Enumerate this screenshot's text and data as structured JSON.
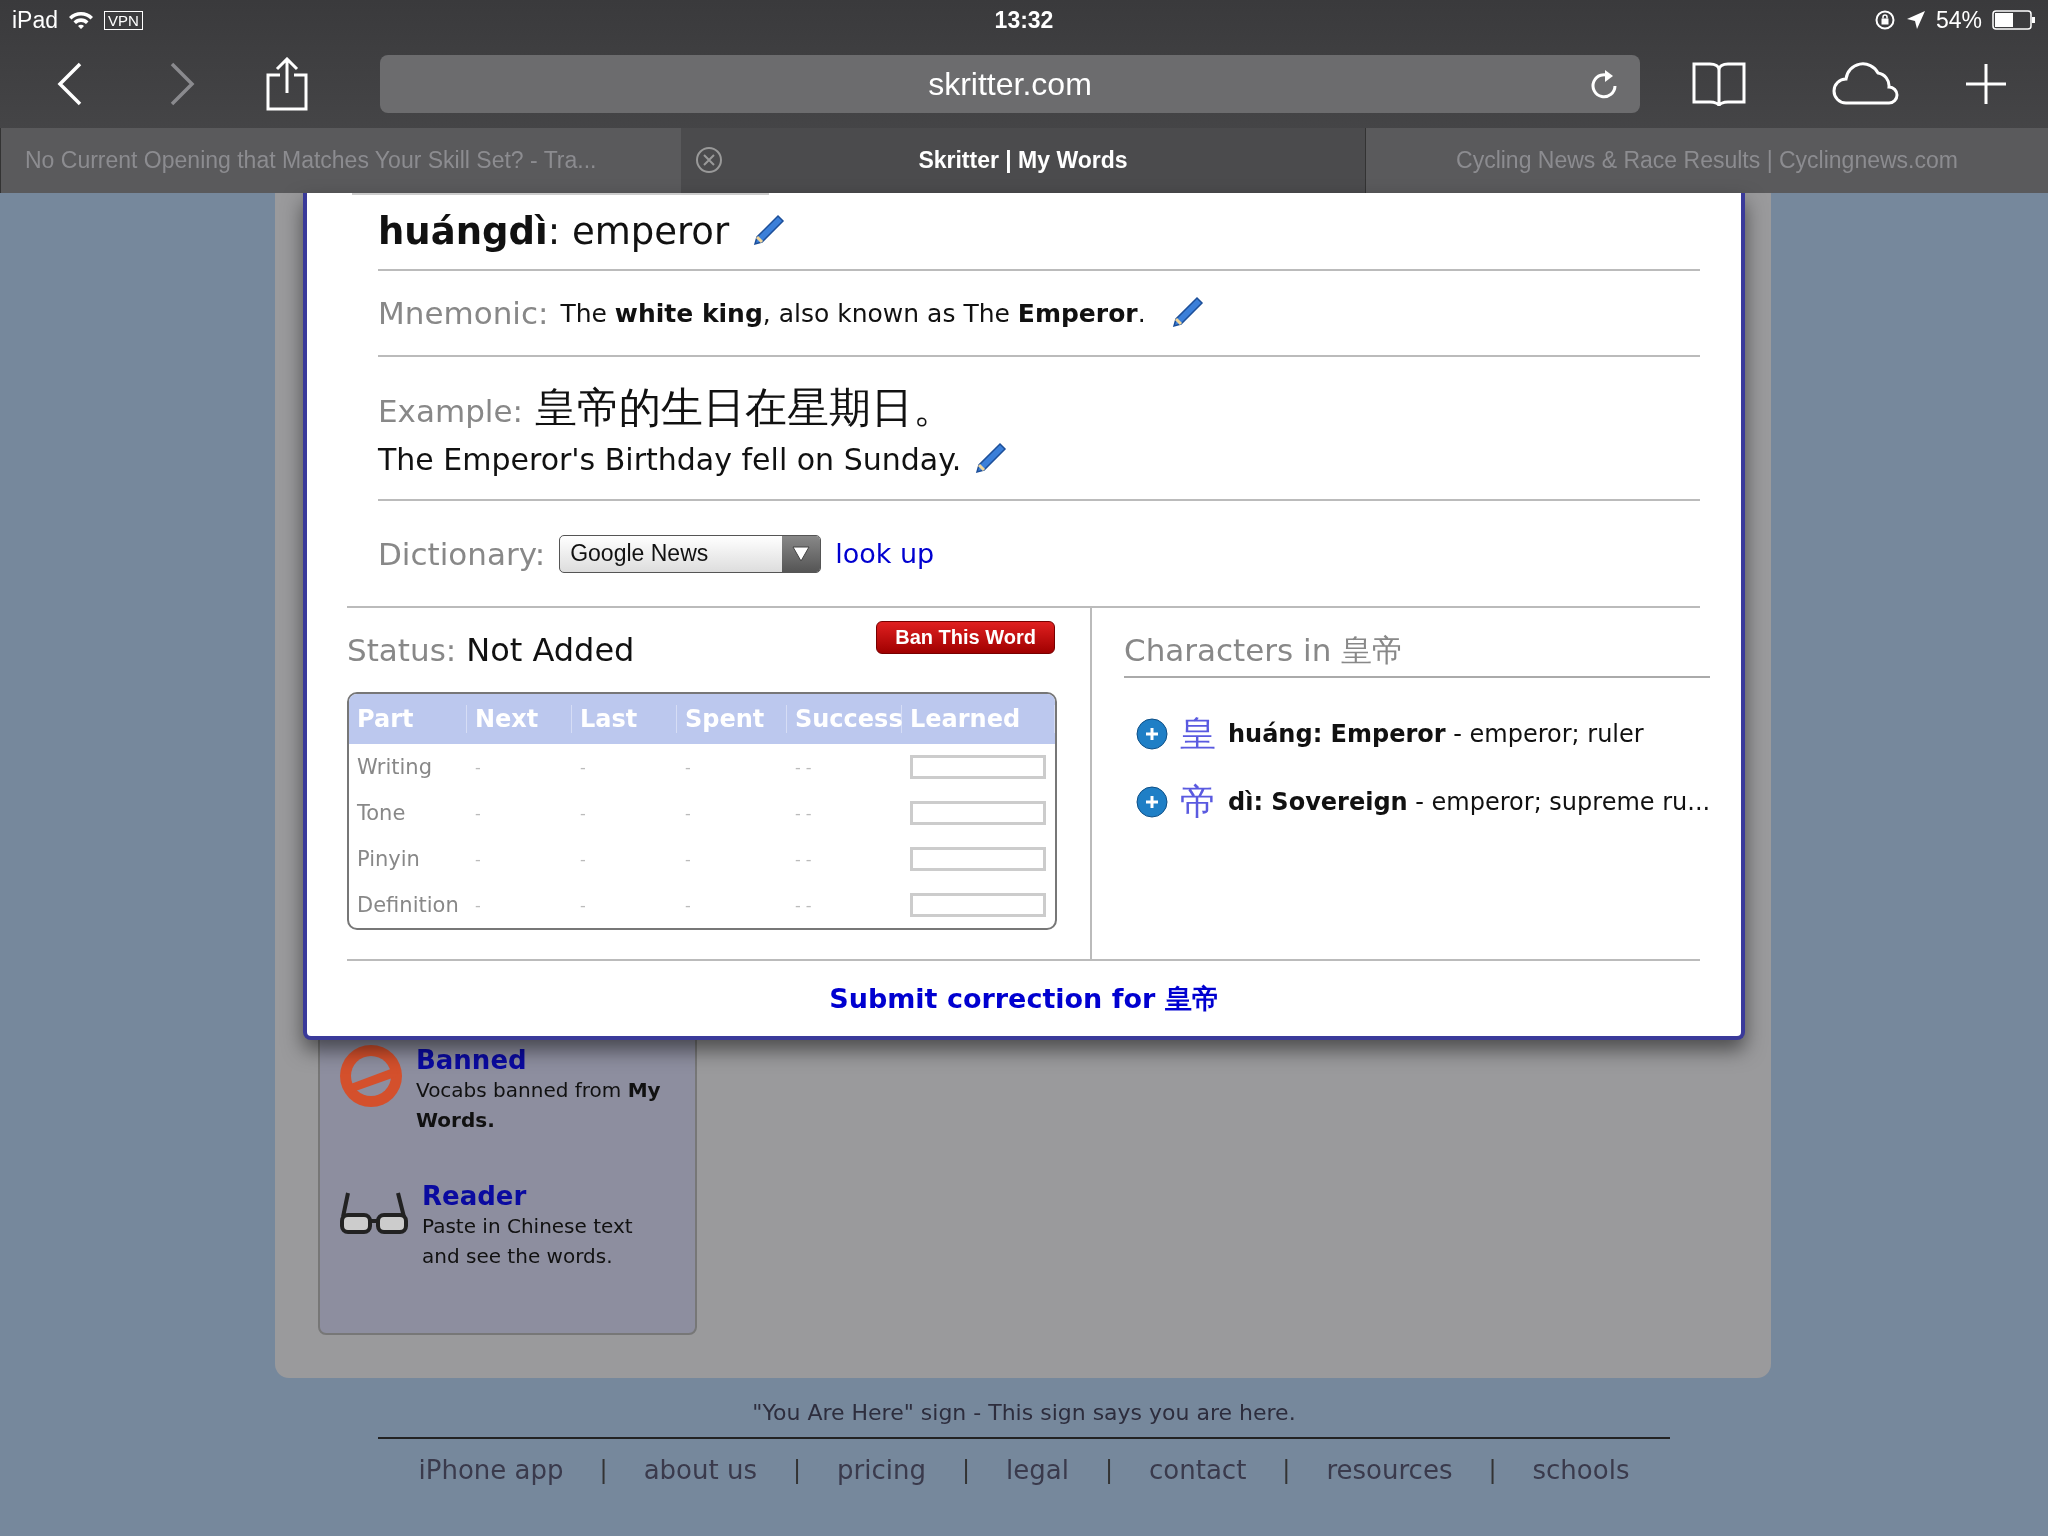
{
  "status_bar": {
    "device": "iPad",
    "vpn": "VPN",
    "time": "13:32",
    "battery": "54%"
  },
  "toolbar": {
    "url": "skritter.com"
  },
  "tabs": [
    {
      "title": "No Current Opening that Matches Your Skill Set? - Tra...",
      "selected": false
    },
    {
      "title": "Skritter | My Words",
      "selected": true
    },
    {
      "title": "Cycling News & Race Results | Cyclingnews.com",
      "selected": false
    }
  ],
  "word_card": {
    "heading": "**huángdì**: emperor",
    "mnemonic_label": "Mnemonic:",
    "mnemonic": "The **white king**, also known as The **Emperor**.",
    "example_label": "Example:",
    "example": "皇帝的生日在星期日。",
    "example_translation": "The Emperor's Birthday fell on Sunday.",
    "dictionary_label": "Dictionary:",
    "dictionary": "Google News",
    "look_up": "look up",
    "status_label": "Status:",
    "status": "Not Added",
    "ban_button": "Ban This Word",
    "progress_table": {
      "columns": [
        "Part",
        "Next",
        "Last",
        "Spent",
        "Success",
        "Learned"
      ],
      "rows": [
        {
          "part": "Writing",
          "next": "-",
          "last": "-",
          "spent": "-",
          "success": "- -",
          "level": 0
        },
        {
          "part": "Tone",
          "next": "-",
          "last": "-",
          "spent": "-",
          "success": "- -",
          "level": 0
        },
        {
          "part": "Pinyin",
          "next": "-",
          "last": "-",
          "spent": "-",
          "success": "- -",
          "level": 0
        },
        {
          "part": "Definition",
          "next": "-",
          "last": "-",
          "spent": "-",
          "success": "- -",
          "level": 0
        }
      ]
    },
    "characters_heading": "Characters in 皇帝",
    "characters": [
      {
        "character": "皇",
        "entry": "**huáng: Emperor** - emperor; ruler"
      },
      {
        "character": "帝",
        "entry": "**dì: Sovereign** - emperor; supreme ru..."
      }
    ],
    "submit_correction": "Submit correction for 皇帝"
  },
  "sidebar": {
    "items": [
      {
        "kind": "banned",
        "title": "Banned",
        "description": "Vocabs banned from **My Words.**"
      },
      {
        "kind": "reader",
        "title": "Reader",
        "description": "Paste in Chinese text and see the words."
      }
    ]
  },
  "footer": {
    "caption": "\"You Are Here\" sign - This sign says you are here.",
    "items": [
      {
        "kind": "link",
        "text": "iPhone app"
      },
      {
        "kind": "separator",
        "text": "|"
      },
      {
        "kind": "link",
        "text": "about us"
      },
      {
        "kind": "separator",
        "text": "|"
      },
      {
        "kind": "link",
        "text": "pricing"
      },
      {
        "kind": "separator",
        "text": "|"
      },
      {
        "kind": "link",
        "text": "legal"
      },
      {
        "kind": "separator",
        "text": "|"
      },
      {
        "kind": "link",
        "text": "contact"
      },
      {
        "kind": "separator",
        "text": "|"
      },
      {
        "kind": "link",
        "text": "resources"
      },
      {
        "kind": "separator",
        "text": "|"
      },
      {
        "kind": "link",
        "text": "schools"
      }
    ]
  }
}
